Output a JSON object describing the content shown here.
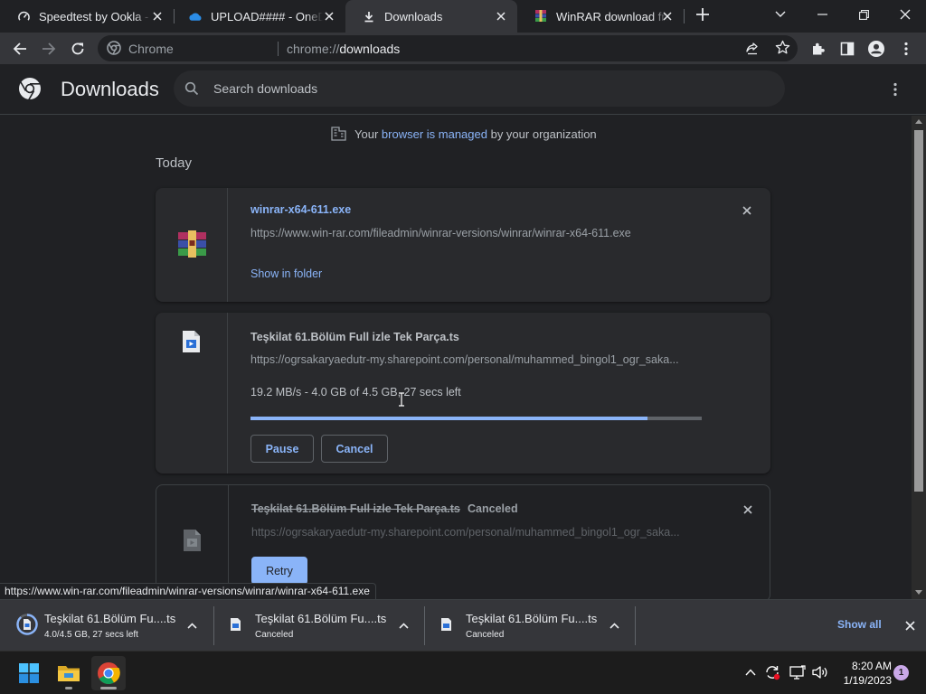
{
  "tabs": [
    {
      "title": "Speedtest by Ookla - The Global Broadband Speed Test",
      "icon": "speedtest-icon"
    },
    {
      "title": "UPLOAD#### - OneDrive",
      "icon": "onedrive-icon"
    },
    {
      "title": "Downloads",
      "icon": "download-icon"
    },
    {
      "title": "WinRAR download free and support",
      "icon": "winrar-icon"
    }
  ],
  "omnibox": {
    "site_label": "Chrome",
    "url_scheme": "chrome://",
    "url_host": "downloads"
  },
  "page": {
    "title": "Downloads",
    "search_placeholder": "Search downloads"
  },
  "managed": {
    "prefix": "Your",
    "link": "browser is managed",
    "suffix": "by your organization"
  },
  "section_date": "Today",
  "downloads": [
    {
      "filename": "winrar-x64-611.exe",
      "url": "https://www.win-rar.com/fileadmin/winrar-versions/winrar/winrar-x64-611.exe",
      "action": "Show in folder"
    },
    {
      "filename": "Teşkilat 61.Bölüm Full izle Tek Parça.ts",
      "url": "https://ogrsakaryaedutr-my.sharepoint.com/personal/muhammed_bingol1_ogr_saka...",
      "status": "19.2 MB/s - 4.0 GB of 4.5 GB, 27 secs left",
      "progress": 0.88,
      "pause_label": "Pause",
      "cancel_label": "Cancel"
    },
    {
      "filename": "Teşkilat 61.Bölüm Full izle Tek Parça.ts",
      "state": "Canceled",
      "url": "https://ogrsakaryaedutr-my.sharepoint.com/personal/muhammed_bingol1_ogr_saka...",
      "retry_label": "Retry"
    }
  ],
  "status_url": "https://www.win-rar.com/fileadmin/winrar-versions/winrar/winrar-x64-611.exe",
  "shelf": {
    "items": [
      {
        "name": "Teşkilat 61.Bölüm Fu....ts",
        "status": "4.0/4.5 GB, 27 secs left"
      },
      {
        "name": "Teşkilat 61.Bölüm Fu....ts",
        "status": "Canceled"
      },
      {
        "name": "Teşkilat 61.Bölüm Fu....ts",
        "status": "Canceled"
      }
    ],
    "show_all": "Show all"
  },
  "taskbar": {
    "time": "8:20 AM",
    "date": "1/19/2023",
    "notification_count": "1"
  },
  "colors": {
    "accent": "#8ab4f8",
    "background": "#202124",
    "card": "#292a2d",
    "toolbar": "#35363a"
  }
}
